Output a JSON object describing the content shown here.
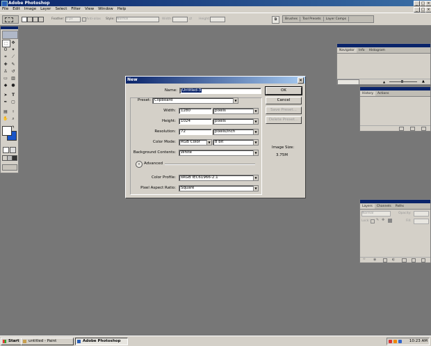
{
  "app": {
    "title": "Adobe Photoshop"
  },
  "menu": [
    "File",
    "Edit",
    "Image",
    "Layer",
    "Select",
    "Filter",
    "View",
    "Window",
    "Help"
  ],
  "options": {
    "feather_label": "Feather:",
    "feather_value": "0 px",
    "antialias_label": "Anti-alias",
    "style_label": "Style:",
    "style_value": "Normal",
    "width_label": "Width:",
    "height_label": "Height:",
    "palette_well": [
      "Brushes",
      "Tool Presets",
      "Layer Comps"
    ]
  },
  "navigator": {
    "tabs": [
      "Navigator",
      "Info",
      "Histogram"
    ]
  },
  "history": {
    "tabs": [
      "History",
      "Actions"
    ]
  },
  "layers": {
    "tabs": [
      "Layers",
      "Channels",
      "Paths"
    ],
    "blend_mode": "Normal",
    "opacity_label": "Opacity:",
    "lock_label": "Lock:",
    "fill_label": "Fill:"
  },
  "dialog": {
    "title": "New",
    "name_label": "Name:",
    "name_value": "Untitled-3",
    "preset_label": "Preset:",
    "preset_value": "Clipboard",
    "width_label": "Width:",
    "width_value": "1280",
    "width_unit": "pixels",
    "height_label": "Height:",
    "height_value": "1024",
    "height_unit": "pixels",
    "resolution_label": "Resolution:",
    "resolution_value": "72",
    "resolution_unit": "pixels/inch",
    "colormode_label": "Color Mode:",
    "colormode_value": "RGB Color",
    "bitdepth_value": "8 bit",
    "background_label": "Background Contents:",
    "background_value": "White",
    "advanced_label": "Advanced",
    "profile_label": "Color Profile:",
    "profile_value": "sRGB IEC61966-2.1",
    "aspect_label": "Pixel Aspect Ratio:",
    "aspect_value": "Square",
    "ok": "OK",
    "cancel": "Cancel",
    "save_preset": "Save Preset...",
    "delete_preset": "Delete Preset...",
    "image_size_label": "Image Size:",
    "image_size_value": "3.75M"
  },
  "taskbar": {
    "start": "Start",
    "items": [
      "untitled - Paint",
      "Adobe Photoshop"
    ],
    "clock": "10:23 AM"
  }
}
